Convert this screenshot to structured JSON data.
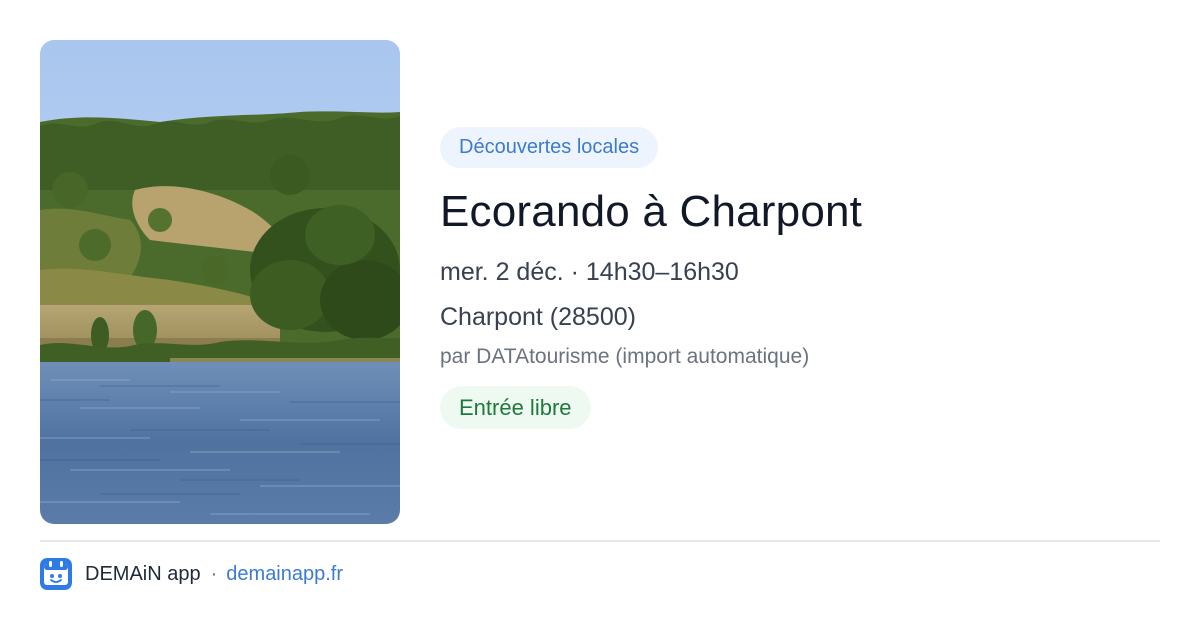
{
  "event": {
    "category": "Découvertes locales",
    "title": "Ecorando à Charpont",
    "datetime": "mer. 2 déc. · 14h30–16h30",
    "location": "Charpont (28500)",
    "source": "par DATAtourisme (import automatique)",
    "price": "Entrée libre",
    "image_icon": "lake-landscape-photo"
  },
  "footer": {
    "app_name": "DEMAiN app",
    "separator": "·",
    "link": "demainapp.fr",
    "logo_icon": "demain-app-logo-icon"
  },
  "colors": {
    "accent": "#3c7bd0",
    "category_bg": "#eef4fd",
    "price_text": "#1d7a3c",
    "price_bg": "#eefaf1",
    "title": "#111827",
    "muted": "#6b7280"
  }
}
